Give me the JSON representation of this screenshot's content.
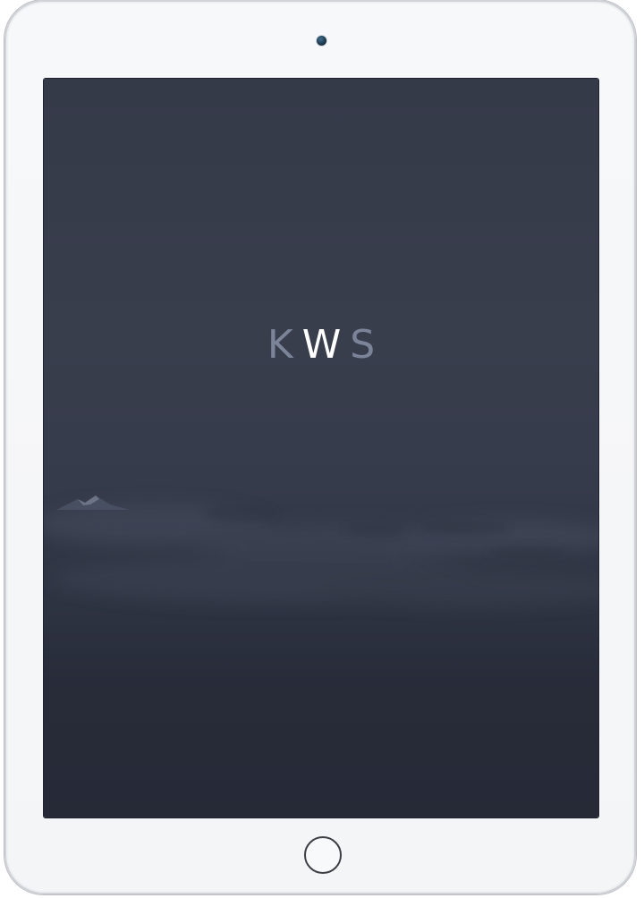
{
  "logo": {
    "letters": [
      "K",
      "W",
      "S"
    ],
    "colors": [
      "#7c8499",
      "#ffffff",
      "#7c8499"
    ]
  },
  "colors": {
    "bezel": "#f5f6f8",
    "screen_top": "#353a49",
    "screen_bottom": "#262a37"
  },
  "icons": {
    "camera": "front-camera-icon",
    "home": "home-button-icon"
  }
}
